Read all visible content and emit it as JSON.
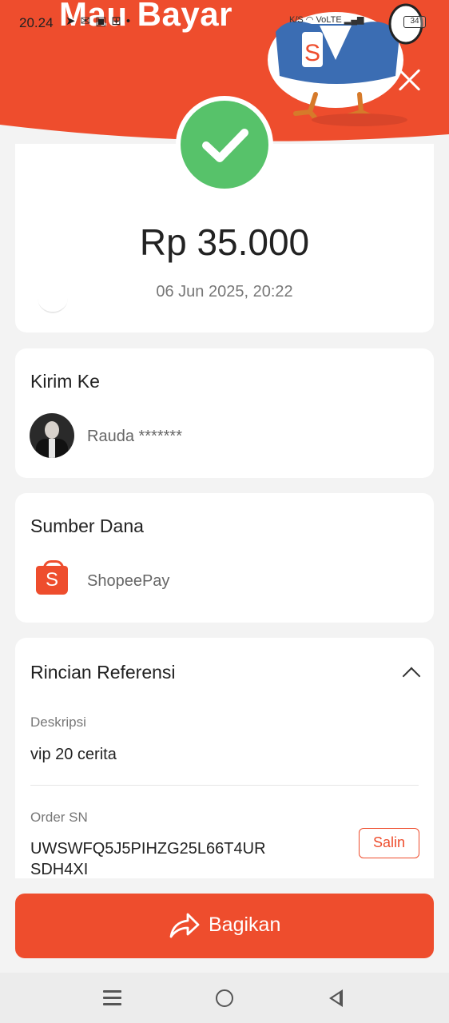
{
  "status_bar": {
    "time": "20.24",
    "network": "VoLTE",
    "speed_unit": "K/S",
    "battery": "34"
  },
  "header": {
    "brand_text": "Mau Bayar",
    "close_icon": "close-icon",
    "mascot": "shopee-chicken-mascot"
  },
  "summary": {
    "status_icon": "checkmark-icon",
    "amount": "Rp 35.000",
    "datetime": "06 Jun 2025, 20:22"
  },
  "recipient": {
    "title": "Kirim Ke",
    "name": "Rauda *******"
  },
  "source": {
    "title": "Sumber Dana",
    "name": "ShopeePay",
    "icon": "shopeepay-icon"
  },
  "reference": {
    "title": "Rincian Referensi",
    "description_label": "Deskripsi",
    "description_value": "vip 20 cerita",
    "order_label": "Order SN",
    "order_value_line1": "UWSWFQ5J5PIHZG25L66T4UR",
    "order_value_line2": "SDH4XI",
    "copy_label": "Salin"
  },
  "actions": {
    "share_label": "Bagikan",
    "share_icon": "share-arrow-icon"
  },
  "colors": {
    "brand": "#ee4d2d",
    "success": "#57c26a",
    "background": "#f3f3f3"
  }
}
